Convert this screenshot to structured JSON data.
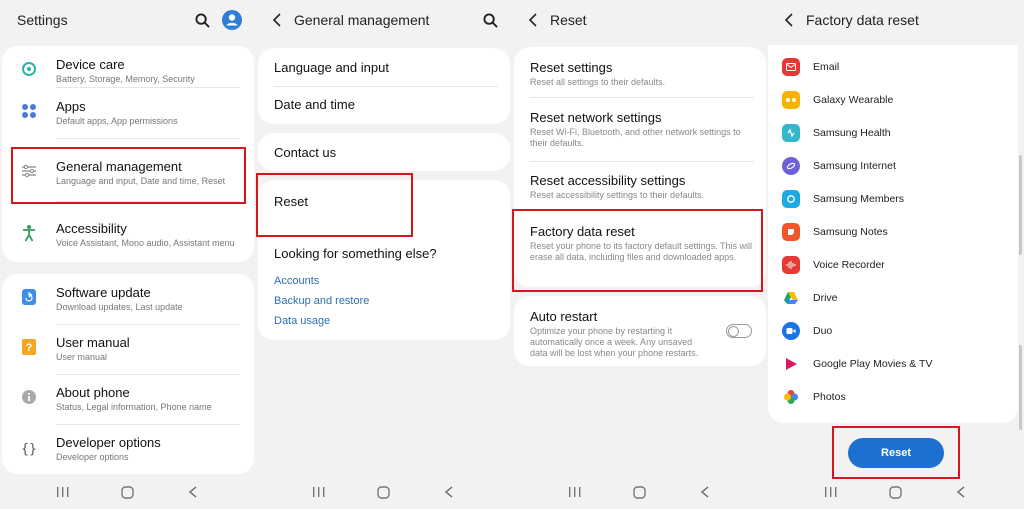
{
  "settings": {
    "title": "Settings",
    "items": [
      {
        "title": "Device care",
        "subtitle": "Battery, Storage, Memory, Security",
        "icon": "device-care-icon"
      },
      {
        "title": "Apps",
        "subtitle": "Default apps, App permissions",
        "icon": "apps-icon"
      },
      {
        "title": "General management",
        "subtitle": "Language and input, Date and time, Reset",
        "icon": "sliders-icon"
      },
      {
        "title": "Accessibility",
        "subtitle": "Voice Assistant, Mono audio, Assistant menu",
        "icon": "accessibility-icon"
      },
      {
        "title": "Software update",
        "subtitle": "Download updates, Last update",
        "icon": "software-update-icon"
      },
      {
        "title": "User manual",
        "subtitle": "User manual",
        "icon": "user-manual-icon"
      },
      {
        "title": "About phone",
        "subtitle": "Status, Legal information, Phone name",
        "icon": "info-icon"
      },
      {
        "title": "Developer options",
        "subtitle": "Developer options",
        "icon": "braces-icon"
      }
    ]
  },
  "general": {
    "title": "General management",
    "items": [
      "Language and input",
      "Date and time",
      "Contact us",
      "Reset"
    ],
    "looking_title": "Looking for something else?",
    "links": [
      "Accounts",
      "Backup and restore",
      "Data usage"
    ]
  },
  "reset": {
    "title": "Reset",
    "items": [
      {
        "title": "Reset settings",
        "subtitle": "Reset all settings to their defaults."
      },
      {
        "title": "Reset network settings",
        "subtitle": "Reset Wi-Fi, Bluetooth, and other network settings to their defaults."
      },
      {
        "title": "Reset accessibility settings",
        "subtitle": "Reset accessibility settings to their defaults."
      },
      {
        "title": "Factory data reset",
        "subtitle": "Reset your phone to its factory default settings. This will erase all data, including files and downloaded apps."
      }
    ],
    "auto_restart": {
      "title": "Auto restart",
      "subtitle": "Optimize your phone by restarting it automatically once a week. Any unsaved data will be lost when your phone restarts.",
      "enabled": false
    }
  },
  "factory": {
    "title": "Factory data reset",
    "apps": [
      {
        "name": "Email",
        "color": "#e53935",
        "icon": "email-icon"
      },
      {
        "name": "Galaxy Wearable",
        "color": "#f5b400",
        "icon": "galaxy-wearable-icon"
      },
      {
        "name": "Samsung Health",
        "color": "#35b6c9",
        "icon": "samsung-health-icon"
      },
      {
        "name": "Samsung Internet",
        "color": "#6f5fd8",
        "icon": "samsung-internet-icon"
      },
      {
        "name": "Samsung Members",
        "color": "#1ea9e0",
        "icon": "samsung-members-icon"
      },
      {
        "name": "Samsung Notes",
        "color": "#f0562b",
        "icon": "samsung-notes-icon"
      },
      {
        "name": "Voice Recorder",
        "color": "#e53935",
        "icon": "voice-recorder-icon"
      },
      {
        "name": "Drive",
        "color": "#1fa463",
        "icon": "drive-icon"
      },
      {
        "name": "Duo",
        "color": "#1a73e8",
        "icon": "duo-icon"
      },
      {
        "name": "Google Play Movies & TV",
        "color": "#d81b60",
        "icon": "play-movies-icon"
      },
      {
        "name": "Photos",
        "color": "#fbbc05",
        "icon": "photos-icon"
      }
    ],
    "reset_label": "Reset"
  },
  "colors": {
    "highlight": "#d6161f",
    "link": "#2b6fb5",
    "button": "#1d6fd0"
  }
}
